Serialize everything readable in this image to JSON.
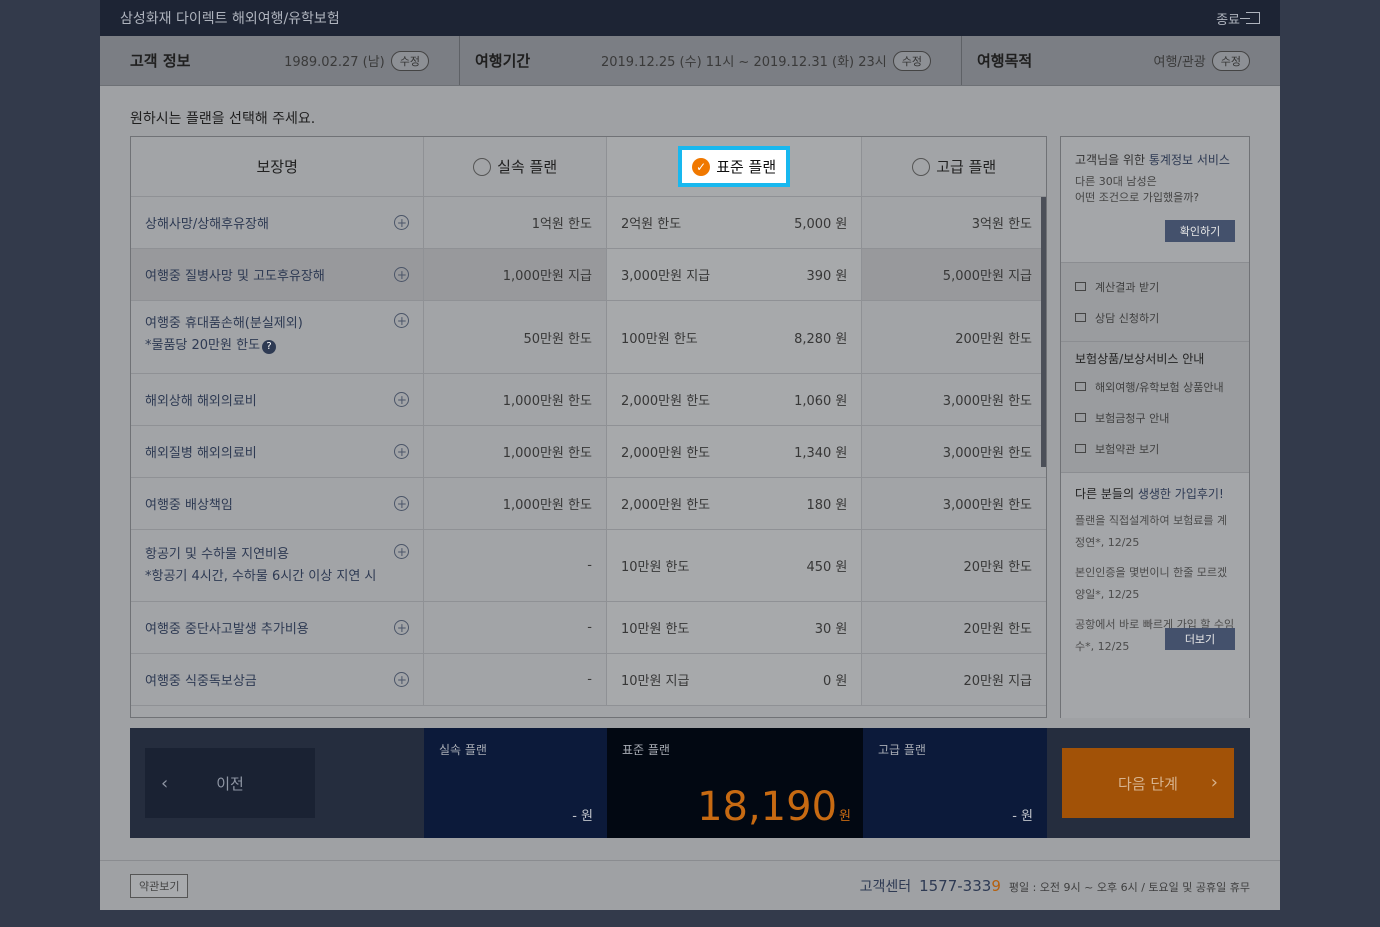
{
  "window": {
    "title": "삼성화재 다이렉트 해외여행/유학보험",
    "close_label": "종료"
  },
  "info": {
    "customer": {
      "label": "고객 정보",
      "value": "1989.02.27 (남)",
      "edit": "수정"
    },
    "period": {
      "label": "여행기간",
      "value": "2019.12.25 (수) 11시 ~ 2019.12.31 (화) 23시",
      "edit": "수정"
    },
    "purpose": {
      "label": "여행목적",
      "value": "여행/관광",
      "edit": "수정"
    }
  },
  "prompt": "원하시는 플랜을 선택해 주세요.",
  "table": {
    "headers": {
      "coverage": "보장명",
      "basic": "실속 플랜",
      "standard": "표준 플랜",
      "premium": "고급 플랜"
    },
    "rows": [
      {
        "name": "상해사망/상해후유장해",
        "basic": "1억원 한도",
        "std": "2억원 한도",
        "std_price": "5,000 원",
        "premium": "3억원 한도"
      },
      {
        "name": "여행중 질병사망 및 고도후유장해",
        "basic": "1,000만원 지급",
        "std": "3,000만원 지급",
        "std_price": "390 원",
        "premium": "5,000만원 지급"
      },
      {
        "name": "여행중 휴대품손해(분실제외)",
        "note": "*물품당 20만원 한도",
        "basic": "50만원 한도",
        "std": "100만원 한도",
        "std_price": "8,280 원",
        "premium": "200만원 한도"
      },
      {
        "name": "해외상해 해외의료비",
        "basic": "1,000만원 한도",
        "std": "2,000만원 한도",
        "std_price": "1,060 원",
        "premium": "3,000만원 한도"
      },
      {
        "name": "해외질병 해외의료비",
        "basic": "1,000만원 한도",
        "std": "2,000만원 한도",
        "std_price": "1,340 원",
        "premium": "3,000만원 한도"
      },
      {
        "name": "여행중 배상책임",
        "basic": "1,000만원 한도",
        "std": "2,000만원 한도",
        "std_price": "180 원",
        "premium": "3,000만원 한도"
      },
      {
        "name": "항공기 및 수하물 지연비용",
        "note": "*항공기 4시간, 수하물 6시간 이상 지연 시",
        "basic": "-",
        "std": "10만원 한도",
        "std_price": "450 원",
        "premium": "20만원 한도"
      },
      {
        "name": "여행중 중단사고발생 추가비용",
        "basic": "-",
        "std": "10만원 한도",
        "std_price": "30 원",
        "premium": "20만원 한도"
      },
      {
        "name": "여행중 식중독보상금",
        "basic": "-",
        "std": "10만원 지급",
        "std_price": "0 원",
        "premium": "20만원 지급"
      }
    ]
  },
  "side": {
    "stats_title_pre": "고객님을 위한 ",
    "stats_title_accent": "통계정보 서비스",
    "stats_q1": "다른 30대 남성은",
    "stats_q2": "어떤 조건으로 가입했을까?",
    "confirm": "확인하기",
    "link_result": "계산결과 받기",
    "link_consult": "상담 신청하기",
    "guide_title": "보험상품/보상서비스 안내",
    "link_product": "해외여행/유학보험 상품안내",
    "link_claim": "보험금청구 안내",
    "link_terms": "보험약관 보기",
    "reviews_title_pre": "다른 분들의 ",
    "reviews_title_accent": "생생한 가입후기!",
    "review1": "플랜을 직접설계하여 보험료를 계정연*, 12/25",
    "review2": "본인인증을 몇번이니 한줄 모르겠양일*, 12/25",
    "review3": "공항에서 바로 빠르게 가입 할 수임수*, 12/25",
    "more": "더보기"
  },
  "bottom": {
    "prev": "이전",
    "basic_label": "실속 플랜",
    "basic_price": "- 원",
    "std_label": "표준 플랜",
    "std_price": "18,190",
    "won": "원",
    "prem_label": "고급 플랜",
    "prem_price": "- 원",
    "next": "다음 단계"
  },
  "footer": {
    "terms": "약관보기",
    "cs_name": "고객센터",
    "cs_phone_main": "1577-333",
    "cs_phone_last": "9",
    "cs_hours": "평일 : 오전 9시 ~ 오후 6시 / 토요일 및 공휴일 휴무"
  },
  "colors": {
    "highlight": "#18b8ef",
    "accent": "#f07800",
    "navy": "#2e3a53"
  }
}
